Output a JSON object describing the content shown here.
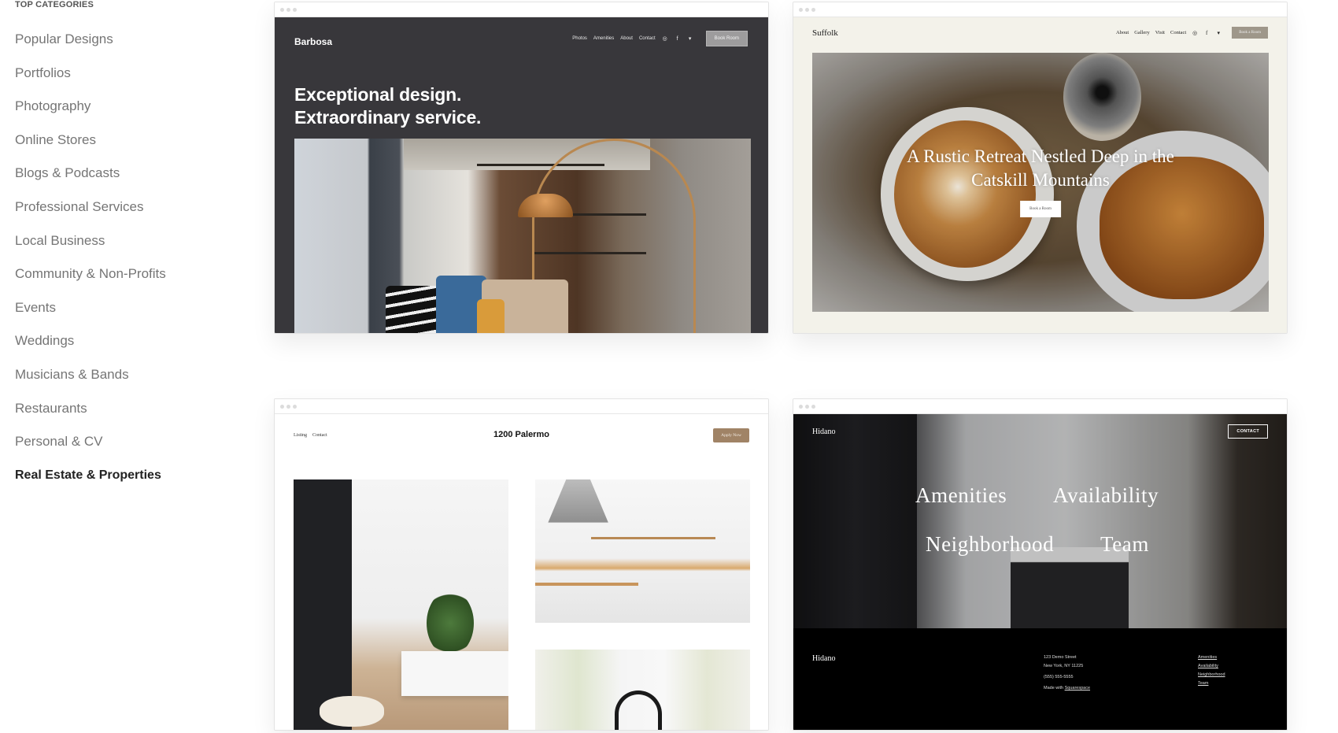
{
  "sidebar": {
    "heading": "TOP CATEGORIES",
    "items": [
      {
        "label": "Popular Designs",
        "active": false
      },
      {
        "label": "Portfolios",
        "active": false
      },
      {
        "label": "Photography",
        "active": false
      },
      {
        "label": "Online Stores",
        "active": false
      },
      {
        "label": "Blogs & Podcasts",
        "active": false
      },
      {
        "label": "Professional Services",
        "active": false
      },
      {
        "label": "Local Business",
        "active": false
      },
      {
        "label": "Community & Non-Profits",
        "active": false
      },
      {
        "label": "Events",
        "active": false
      },
      {
        "label": "Weddings",
        "active": false
      },
      {
        "label": "Musicians & Bands",
        "active": false
      },
      {
        "label": "Restaurants",
        "active": false
      },
      {
        "label": "Personal & CV",
        "active": false
      },
      {
        "label": "Real Estate & Properties",
        "active": true
      }
    ]
  },
  "templates": {
    "barbosa": {
      "logo": "Barbosa",
      "nav": [
        "Photos",
        "Amenities",
        "About",
        "Contact"
      ],
      "social_icons": [
        "instagram-icon",
        "facebook-icon",
        "twitter-icon"
      ],
      "button": "Book Room",
      "headline_line1": "Exceptional design.",
      "headline_line2": "Extraordinary service.",
      "bg_color": "#38373b"
    },
    "suffolk": {
      "logo": "Suffolk",
      "nav": [
        "About",
        "Gallery",
        "Visit",
        "Contact"
      ],
      "social_icons": [
        "instagram-icon",
        "facebook-icon",
        "twitter-icon"
      ],
      "button": "Book a Room",
      "headline_line1": "A Rustic Retreat Nestled Deep in the",
      "headline_line2": "Catskill Mountains",
      "cta": "Book a Room",
      "bg_color": "#f3f2ea"
    },
    "palermo": {
      "nav": [
        "Listing",
        "Contact"
      ],
      "title": "1200 Palermo",
      "button": "Apply Now",
      "accent_color": "#a08366"
    },
    "hidano": {
      "logo": "Hidano",
      "button": "CONTACT",
      "menu": [
        "Amenities",
        "Availability",
        "Neighborhood",
        "Team"
      ],
      "footer": {
        "logo": "Hidano",
        "address_line1": "123 Demo Street",
        "address_line2": "New York, NY 11225",
        "phone": "(555) 555-5555",
        "made_with_prefix": "Made with",
        "made_with_link": "Squarespace",
        "links": [
          "Amenities",
          "Availability",
          "Neighborhood",
          "Team"
        ]
      }
    }
  },
  "icons": {
    "instagram": "◎",
    "facebook": "f",
    "twitter": "🐦"
  }
}
